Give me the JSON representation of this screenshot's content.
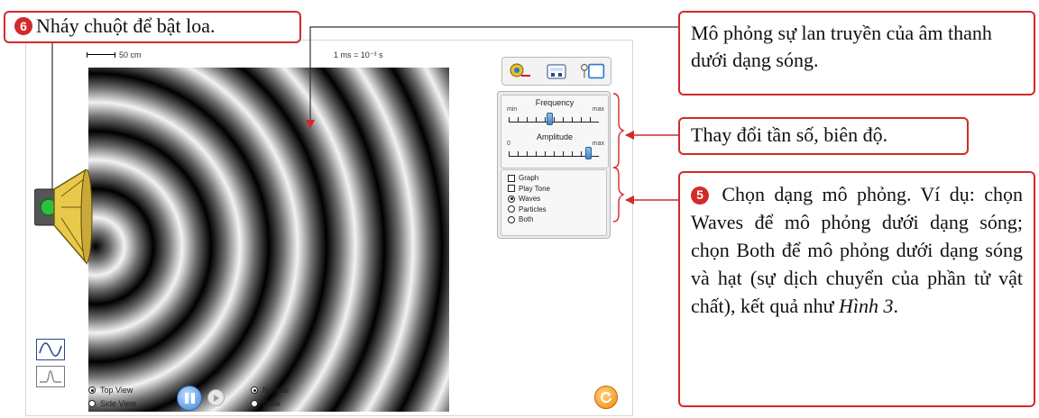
{
  "simulation": {
    "scale_label": "50 cm",
    "time_scale_label": "1 ms = 10⁻³ s",
    "controls": {
      "frequency_label": "Frequency",
      "amplitude_label": "Amplitude",
      "freq_min": "min",
      "freq_max": "max",
      "amp_min": "0",
      "amp_max": "max",
      "frequency_level": 0.45,
      "amplitude_level": 0.88
    },
    "options": {
      "graph": "Graph",
      "play_tone": "Play Tone",
      "waves": "Waves",
      "particles": "Particles",
      "both": "Both",
      "selected": "Waves"
    },
    "view": {
      "top": "Top View",
      "side": "Side View",
      "selected": "Top View"
    },
    "speed": {
      "normal": "Normal",
      "slow": "Slow",
      "selected": "Normal"
    },
    "icons": [
      "speaker-measure-icon",
      "stopwatch-icon",
      "pressure-meter-icon",
      "sine-wave-icon",
      "pulse-wave-icon",
      "pause-icon",
      "step-icon",
      "reset-icon"
    ],
    "colors": {
      "accent_blue": "#3d82d6",
      "reset_orange": "#ef8a12"
    }
  },
  "callouts": {
    "step6_number": "6",
    "step6_text": "Nháy chuột để bật loa.",
    "propagation_text": "Mô phỏng sự lan truyền của âm thanh dưới dạng sóng.",
    "frequency_amplitude_text": "Thay đổi tần số, biên độ.",
    "step5_number": "5",
    "step5_text": " Chọn dạng mô phỏng. Ví dụ: chọn Waves để mô phỏng dưới dạng sóng; chọn Both để mô phỏng dưới dạng sóng và hạt (sự dịch chuyển của phần tử vật chất), kết quả như ",
    "step5_ref": "Hình 3",
    "step5_end": ".",
    "color": "#d22a2a"
  }
}
